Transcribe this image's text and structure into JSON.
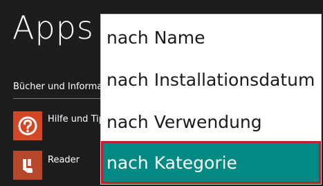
{
  "header": {
    "title": "Apps"
  },
  "section": {
    "label": "Bücher und Informa"
  },
  "apps": [
    {
      "label": "Hilfe und Tip",
      "icon": "help-icon",
      "color": "#d24726"
    },
    {
      "label": "Reader",
      "icon": "reader-icon",
      "color": "#b7472a"
    }
  ],
  "sort_menu": {
    "items": [
      {
        "label": "nach Name"
      },
      {
        "label": "nach Installationsdatum"
      },
      {
        "label": "nach Verwendung"
      },
      {
        "label": "nach Kategorie",
        "selected": true
      }
    ],
    "highlight_color": "#008a83",
    "focus_border_color": "#c31d2b"
  }
}
